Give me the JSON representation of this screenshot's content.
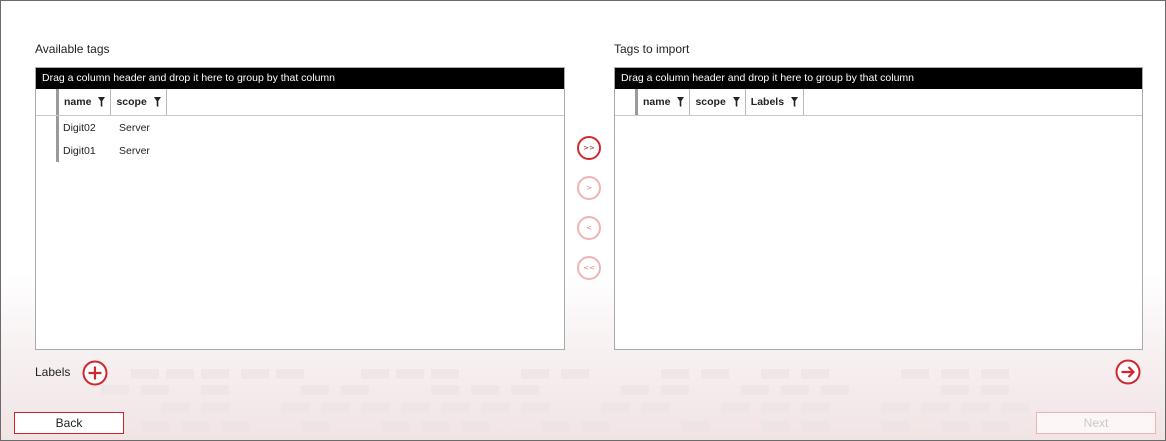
{
  "colors": {
    "accent": "#d0282e",
    "accent_disabled": "#efb3b6",
    "header_black": "#000000"
  },
  "available": {
    "title": "Available tags",
    "group_hint": "Drag a column header and drop it here to group by that column",
    "columns": [
      "name",
      "scope"
    ],
    "rows": [
      {
        "name": "Digit02",
        "scope": "Server"
      },
      {
        "name": "Digit01",
        "scope": "Server"
      }
    ]
  },
  "import": {
    "title": "Tags to import",
    "group_hint": "Drag a column header and drop it here to group by that column",
    "columns": [
      "name",
      "scope",
      "Labels"
    ]
  },
  "transfer": {
    "add_all": ">>",
    "add_one": ">",
    "remove_one": "<",
    "remove_all": "<<"
  },
  "labels": {
    "text": "Labels",
    "add_icon": "plus-circle-icon"
  },
  "forward_icon": "arrow-right-circle-icon",
  "buttons": {
    "back": "Back",
    "next": "Next"
  }
}
